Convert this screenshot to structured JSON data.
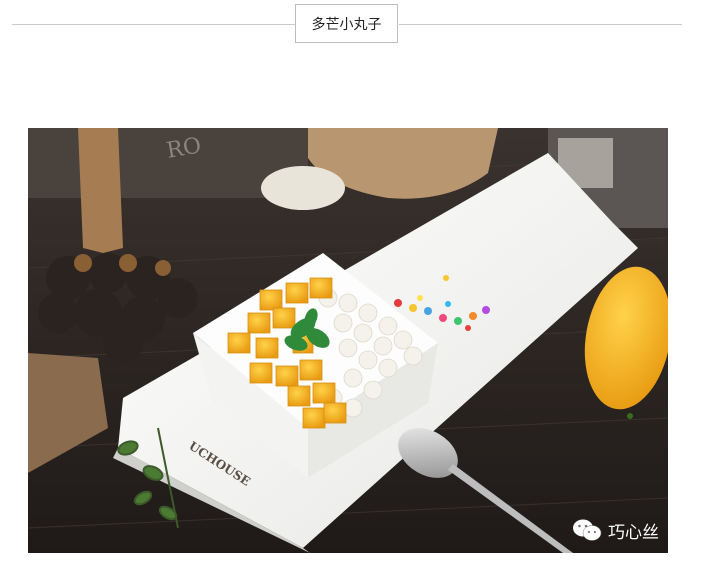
{
  "header": {
    "title": "多芒小丸子"
  },
  "photo": {
    "plate_brand": "UCHOUSE",
    "watermark_text": "巧心丝",
    "watermark_icon": "wechat-icon"
  },
  "colors": {
    "rule": "#c8c8c8",
    "title_border": "#bdbdbd",
    "mango": "#f6a623",
    "background_wood": "#2c2623",
    "plate": "#f6f6f4"
  }
}
